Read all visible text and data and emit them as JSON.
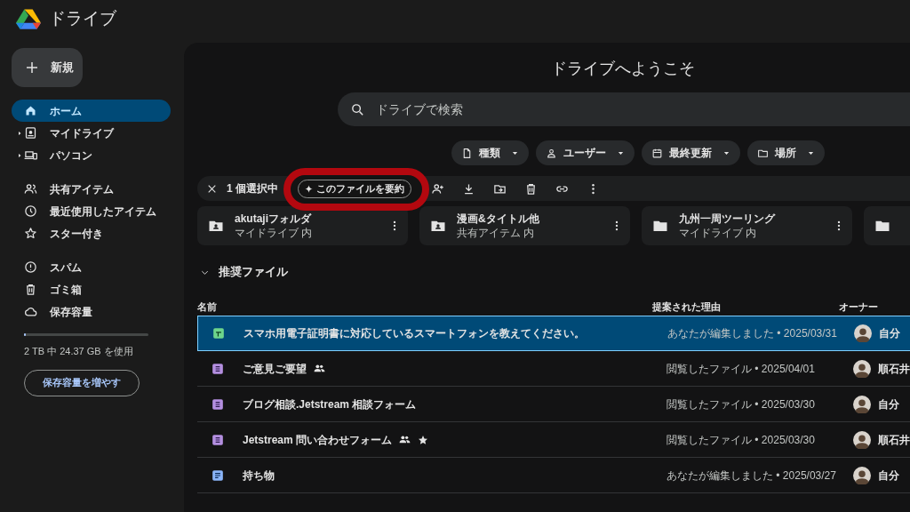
{
  "app": {
    "title": "ドライブ"
  },
  "new_button": "新規",
  "sidebar": {
    "items": [
      {
        "label": "ホーム",
        "selected": true,
        "expandable": false
      },
      {
        "label": "マイドライブ",
        "selected": false,
        "expandable": true
      },
      {
        "label": "パソコン",
        "selected": false,
        "expandable": true
      },
      {
        "label": "共有アイテム",
        "selected": false,
        "expandable": false
      },
      {
        "label": "最近使用したアイテム",
        "selected": false,
        "expandable": false
      },
      {
        "label": "スター付き",
        "selected": false,
        "expandable": false
      },
      {
        "label": "スパム",
        "selected": false,
        "expandable": false
      },
      {
        "label": "ゴミ箱",
        "selected": false,
        "expandable": false
      },
      {
        "label": "保存容量",
        "selected": false,
        "expandable": false
      }
    ],
    "storage": {
      "level": 0.012,
      "text": "2 TB 中 24.37 GB を使用",
      "button": "保存容量を増やす"
    }
  },
  "main": {
    "heading": "ドライブへようこそ",
    "search": {
      "placeholder": "ドライブで検索"
    },
    "filters": [
      {
        "label": "種類"
      },
      {
        "label": "ユーザー"
      },
      {
        "label": "最終更新"
      },
      {
        "label": "場所"
      }
    ],
    "selection_bar": {
      "count": "1 個選択中",
      "summarize": "このファイルを要約",
      "highlighted": true
    },
    "folders": [
      {
        "name": "akutajiフォルダ",
        "location": "マイドライブ 内",
        "shared": true
      },
      {
        "name": "漫画&タイトル他",
        "location": "共有アイテム 内",
        "shared": true
      },
      {
        "name": "九州一周ツーリング",
        "location": "マイドライブ 内",
        "shared": false
      },
      {
        "shared": false
      }
    ],
    "section": "推奨ファイル",
    "table": {
      "columns": [
        "名前",
        "提案された理由",
        "オーナー"
      ],
      "rows": [
        {
          "kind": "sheet",
          "name": "スマホ用電子証明書に対応しているスマートフォンを教えてください。",
          "shared": false,
          "starred": false,
          "reason": "あなたが編集しました • 2025/03/31",
          "owner": "自分",
          "selected": true
        },
        {
          "kind": "form",
          "name": "ご意見ご要望",
          "shared": true,
          "starred": false,
          "reason": "閲覧したファイル • 2025/04/01",
          "owner": "順石井",
          "selected": false
        },
        {
          "kind": "form",
          "name": "ブログ相談.Jetstream 相談フォーム",
          "shared": false,
          "starred": false,
          "reason": "閲覧したファイル • 2025/03/30",
          "owner": "自分",
          "selected": false
        },
        {
          "kind": "form",
          "name": "Jetstream 問い合わせフォーム",
          "shared": true,
          "starred": true,
          "reason": "閲覧したファイル • 2025/03/30",
          "owner": "順石井",
          "selected": false
        },
        {
          "kind": "doc",
          "name": "持ち物",
          "shared": false,
          "starred": false,
          "reason": "あなたが編集しました • 2025/03/27",
          "owner": "自分",
          "selected": false
        }
      ]
    }
  }
}
